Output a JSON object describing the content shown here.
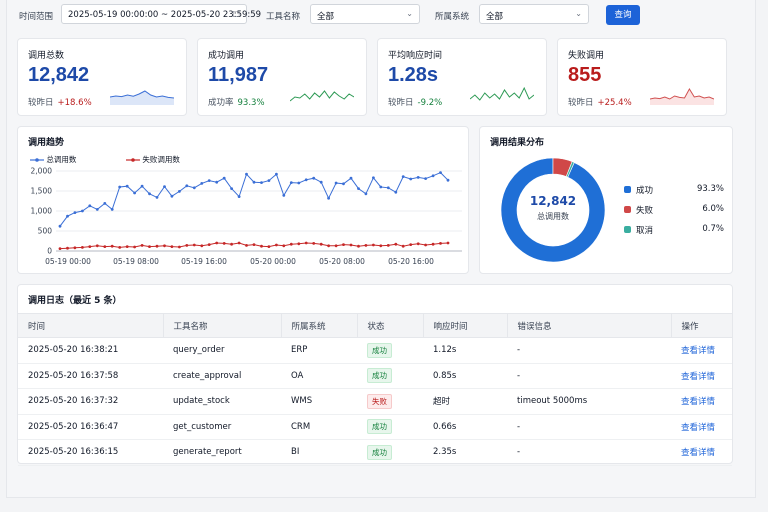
{
  "filters": {
    "time_label": "时间范围",
    "time_value": "2025-05-19 00:00:00 ~ 2025-05-20 23:59:59",
    "tool_label": "工具名称",
    "tool_value": "全部",
    "system_label": "所属系统",
    "system_value": "全部",
    "query_button": "查询"
  },
  "stats": [
    {
      "label": "调用总数",
      "value": "12,842",
      "sub_label": "较昨日",
      "sub_value": "+18.6%",
      "value_color": "#1e4aa8",
      "sub_color": "#b91c1c",
      "spark_color": "#3b6fd6",
      "spark_fill": "#dce6f8",
      "spark": [
        0.4,
        0.45,
        0.42,
        0.5,
        0.44,
        0.55,
        0.7,
        0.5,
        0.4,
        0.45,
        0.38,
        0.35
      ]
    },
    {
      "label": "成功调用",
      "value": "11,987",
      "sub_label": "成功率",
      "sub_value": "93.3%",
      "value_color": "#1e4aa8",
      "sub_color": "#15803d",
      "spark_color": "#2e9a55",
      "spark_fill": "#ffffff",
      "spark": [
        0.2,
        0.4,
        0.35,
        0.55,
        0.3,
        0.6,
        0.4,
        0.7,
        0.35,
        0.65,
        0.45,
        0.3,
        0.55,
        0.4
      ]
    },
    {
      "label": "平均响应时间",
      "value": "1.28s",
      "sub_label": "较昨日",
      "sub_value": "-9.2%",
      "value_color": "#1e4aa8",
      "sub_color": "#15803d",
      "spark_color": "#2e9a55",
      "spark_fill": "#ffffff",
      "spark": [
        0.3,
        0.5,
        0.25,
        0.6,
        0.35,
        0.55,
        0.3,
        0.75,
        0.4,
        0.6,
        0.35,
        0.85,
        0.3,
        0.5
      ]
    },
    {
      "label": "失败调用",
      "value": "855",
      "sub_label": "较昨日",
      "sub_value": "+25.4%",
      "value_color": "#b91c1c",
      "sub_color": "#b91c1c",
      "spark_color": "#d05050",
      "spark_fill": "#fbe3e3",
      "spark": [
        0.3,
        0.35,
        0.32,
        0.4,
        0.3,
        0.45,
        0.38,
        0.35,
        0.8,
        0.4,
        0.45,
        0.35,
        0.4,
        0.3
      ]
    }
  ],
  "trend": {
    "title": "调用趋势",
    "legend_total": "总调用数",
    "legend_failed": "失败调用数",
    "color_total": "#3b6fd6",
    "color_failed": "#c62828"
  },
  "chart_data": {
    "type": "line",
    "title": "调用趋势",
    "x_tick_labels": [
      "05-19 00:00",
      "05-19 08:00",
      "05-19 16:00",
      "05-20 00:00",
      "05-20 08:00",
      "05-20 16:00"
    ],
    "y_ticks": [
      0,
      500,
      1000,
      1500,
      2000
    ],
    "y_tick_labels": [
      "0",
      "500",
      "1,000",
      "1,500",
      "2,000"
    ],
    "ylim": [
      0,
      2000
    ],
    "series": [
      {
        "name": "总调用数",
        "values": [
          620,
          870,
          960,
          1000,
          1130,
          1040,
          1190,
          1040,
          1600,
          1620,
          1450,
          1620,
          1430,
          1340,
          1610,
          1370,
          1490,
          1630,
          1580,
          1690,
          1760,
          1720,
          1820,
          1560,
          1360,
          1920,
          1720,
          1710,
          1760,
          1920,
          1390,
          1710,
          1700,
          1780,
          1820,
          1720,
          1320,
          1700,
          1680,
          1820,
          1560,
          1430,
          1830,
          1600,
          1580,
          1470,
          1860,
          1800,
          1840,
          1810,
          1880,
          1960,
          1770
        ]
      },
      {
        "name": "失败调用数",
        "values": [
          60,
          70,
          80,
          90,
          110,
          130,
          110,
          120,
          90,
          110,
          100,
          140,
          110,
          120,
          130,
          110,
          100,
          140,
          150,
          130,
          160,
          200,
          190,
          170,
          200,
          140,
          160,
          120,
          110,
          150,
          130,
          170,
          180,
          200,
          190,
          170,
          130,
          130,
          160,
          150,
          120,
          140,
          150,
          130,
          140,
          170,
          120,
          160,
          180,
          150,
          170,
          190,
          200
        ]
      }
    ]
  },
  "distribution": {
    "title": "调用结果分布",
    "center_value": "12,842",
    "center_label": "总调用数",
    "items": [
      {
        "name": "成功",
        "percent": "93.3%",
        "value": 93.3,
        "color": "#1f6fd6"
      },
      {
        "name": "失败",
        "percent": "6.0%",
        "value": 6.0,
        "color": "#d04848"
      },
      {
        "name": "取消",
        "percent": "0.7%",
        "value": 0.7,
        "color": "#3aaea0"
      }
    ]
  },
  "logs": {
    "title": "调用日志（最近 5 条）",
    "columns": [
      "时间",
      "工具名称",
      "所属系统",
      "状态",
      "响应时间",
      "错误信息",
      "操作"
    ],
    "rows": [
      {
        "time": "2025-05-20 16:38:21",
        "tool": "query_order",
        "system": "ERP",
        "status": "成功",
        "ok": true,
        "resp": "1.12s",
        "error": "-",
        "action": "查看详情"
      },
      {
        "time": "2025-05-20 16:37:58",
        "tool": "create_approval",
        "system": "OA",
        "status": "成功",
        "ok": true,
        "resp": "0.85s",
        "error": "-",
        "action": "查看详情"
      },
      {
        "time": "2025-05-20 16:37:32",
        "tool": "update_stock",
        "system": "WMS",
        "status": "失败",
        "ok": false,
        "resp": "超时",
        "error": "timeout 5000ms",
        "action": "查看详情"
      },
      {
        "time": "2025-05-20 16:36:47",
        "tool": "get_customer",
        "system": "CRM",
        "status": "成功",
        "ok": true,
        "resp": "0.66s",
        "error": "-",
        "action": "查看详情"
      },
      {
        "time": "2025-05-20 16:36:15",
        "tool": "generate_report",
        "system": "BI",
        "status": "成功",
        "ok": true,
        "resp": "2.35s",
        "error": "-",
        "action": "查看详情"
      }
    ]
  }
}
